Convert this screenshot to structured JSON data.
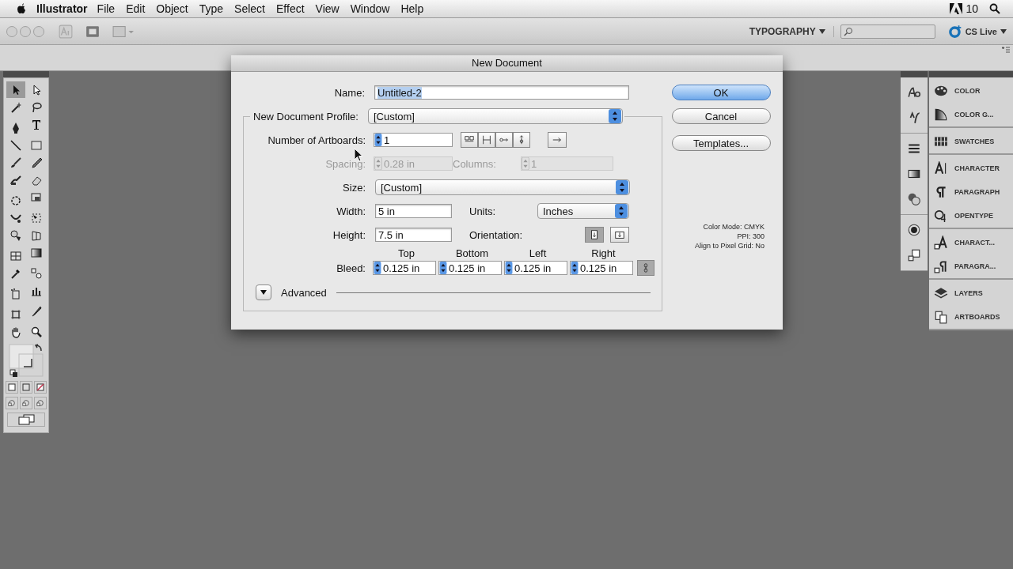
{
  "menu_bar": {
    "app": "Illustrator",
    "items": [
      "File",
      "Edit",
      "Object",
      "Type",
      "Select",
      "Effect",
      "View",
      "Window",
      "Help"
    ],
    "status": "10"
  },
  "app_bar": {
    "workspace": "TYPOGRAPHY",
    "cs_live": "CS Live"
  },
  "toolbox": {
    "tools": [
      {
        "selected": true
      },
      {
        "selected": false
      },
      {
        "selected": false
      },
      {
        "selected": false
      },
      {
        "selected": false
      },
      {
        "selected": false
      },
      {
        "selected": false
      },
      {
        "selected": false
      },
      {
        "selected": false
      },
      {
        "selected": false
      },
      {
        "selected": false
      },
      {
        "selected": false
      },
      {
        "selected": false
      },
      {
        "selected": false
      },
      {
        "selected": false
      },
      {
        "selected": false
      },
      {
        "selected": false
      },
      {
        "selected": false
      },
      {
        "selected": false
      },
      {
        "selected": false
      },
      {
        "selected": false
      },
      {
        "selected": false
      },
      {
        "selected": false
      },
      {
        "selected": false
      },
      {
        "selected": false
      },
      {
        "selected": false
      },
      {
        "selected": false
      },
      {
        "selected": false
      }
    ]
  },
  "dialog": {
    "title": "New Document",
    "name": {
      "label": "Name:",
      "value": "Untitled-2",
      "text_selected": true
    },
    "profile": {
      "label": "New Document Profile:",
      "value": "[Custom]"
    },
    "artboards": {
      "label": "Number of Artboards:",
      "value": "1"
    },
    "spacing": {
      "label": "Spacing:",
      "value": "0.28 in",
      "disabled": true
    },
    "columns": {
      "label": "Columns:",
      "value": "1",
      "disabled": true
    },
    "size": {
      "label": "Size:",
      "value": "[Custom]"
    },
    "width": {
      "label": "Width:",
      "value": "5 in"
    },
    "units": {
      "label": "Units:",
      "value": "Inches"
    },
    "height": {
      "label": "Height:",
      "value": "7.5 in"
    },
    "orientation": {
      "label": "Orientation:",
      "options": [
        {
          "selected": true
        },
        {
          "selected": false
        }
      ]
    },
    "bleed": {
      "label": "Bleed:",
      "fields": [
        {
          "heading": "Top",
          "value": "0.125 in"
        },
        {
          "heading": "Bottom",
          "value": "0.125 in"
        },
        {
          "heading": "Left",
          "value": "0.125 in"
        },
        {
          "heading": "Right",
          "value": "0.125 in"
        }
      ],
      "linked": true
    },
    "advanced": {
      "label": "Advanced",
      "expanded": false
    },
    "buttons": [
      {
        "label": "OK",
        "default": true
      },
      {
        "label": "Cancel",
        "default": false
      },
      {
        "label": "Templates...",
        "default": false
      }
    ],
    "info": [
      "Color Mode: CMYK",
      "PPI: 300",
      "Align to Pixel Grid: No"
    ]
  },
  "panels": {
    "groups": [
      {
        "items": [
          {
            "label": "COLOR"
          },
          {
            "label": "COLOR G..."
          }
        ]
      },
      {
        "items": [
          {
            "label": "SWATCHES"
          }
        ]
      },
      {
        "items": [
          {
            "label": "CHARACTER"
          },
          {
            "label": "PARAGRAPH"
          },
          {
            "label": "OPENTYPE"
          }
        ]
      },
      {
        "items": [
          {
            "label": "CHARACT..."
          },
          {
            "label": "PARAGRA..."
          }
        ]
      },
      {
        "items": [
          {
            "label": "LAYERS"
          },
          {
            "label": "ARTBOARDS"
          }
        ]
      }
    ]
  }
}
